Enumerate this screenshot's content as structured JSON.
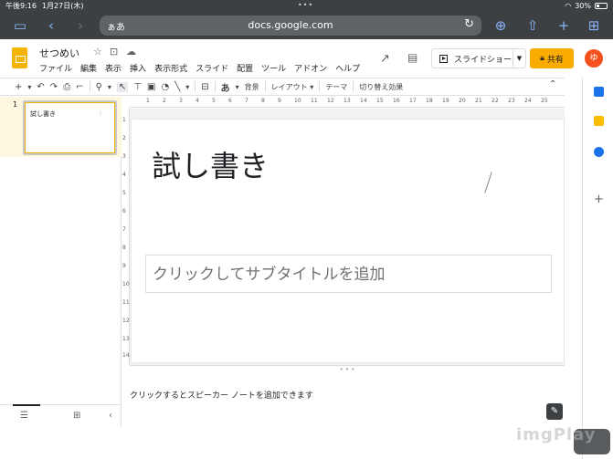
{
  "status_bar": {
    "time": "午後9:16",
    "date": "1月27日(木)",
    "battery": "30%"
  },
  "browser": {
    "text_size": "ぁあ",
    "url": "docs.google.com"
  },
  "document": {
    "title": "せつめい",
    "menu": [
      "ファイル",
      "編集",
      "表示",
      "挿入",
      "表示形式",
      "スライド",
      "配置",
      "ツール",
      "アドオン",
      "ヘルプ"
    ]
  },
  "header_actions": {
    "slideshow_label": "スライドショー",
    "share_label": "共有",
    "avatar_initial": "ゆ"
  },
  "toolbar": {
    "text_style": "あ",
    "background_label": "背景",
    "layout_label": "レイアウト",
    "theme_label": "テーマ",
    "transition_label": "切り替え効果"
  },
  "filmstrip": {
    "slides": [
      {
        "number": "1",
        "title": "試し書き"
      }
    ]
  },
  "ruler": {
    "horizontal": [
      "1",
      "2",
      "3",
      "4",
      "5",
      "6",
      "7",
      "8",
      "9",
      "10",
      "11",
      "12",
      "13",
      "14",
      "15",
      "16",
      "17",
      "18",
      "19",
      "20",
      "21",
      "22",
      "23",
      "24",
      "25"
    ],
    "vertical": [
      "1",
      "2",
      "3",
      "4",
      "5",
      "6",
      "7",
      "8",
      "9",
      "10",
      "11",
      "12",
      "13",
      "14"
    ]
  },
  "slide": {
    "title": "試し書き",
    "subtitle_placeholder": "クリックしてサブタイトルを追加"
  },
  "notes": {
    "placeholder": "クリックするとスピーカー ノートを追加できます"
  },
  "watermark": "imgPlay",
  "colors": {
    "chrome_dark": "#3c4043",
    "brand_yellow": "#f4b400",
    "share_yellow": "#f9ab00",
    "avatar_orange": "#f4511e"
  }
}
